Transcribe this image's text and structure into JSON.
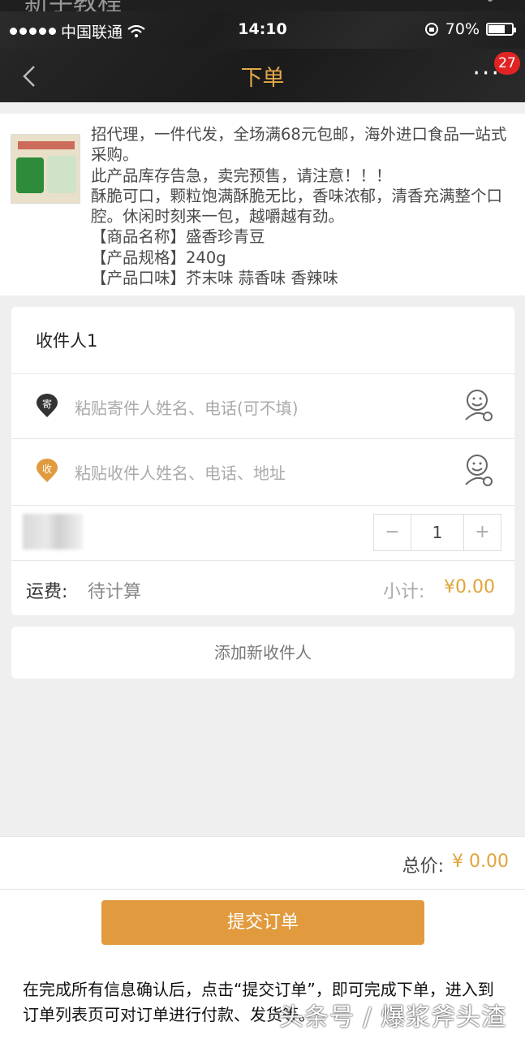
{
  "top_clip": {
    "text": "新手教程"
  },
  "status_bar": {
    "carrier": "中国联通",
    "time": "14:10",
    "battery": "70%",
    "battery_level": 0.7,
    "wifi_icon": "wifi-icon",
    "lock_icon": "rotation-lock-icon"
  },
  "nav": {
    "title": "下单",
    "back_icon": "chevron-left-icon",
    "more_icon": "ellipsis-icon",
    "badge": "27"
  },
  "product": {
    "lines": [
      "招代理，一件代发，全场满68元包邮，海外进口食品一站式采购。",
      "此产品库存告急，卖完预售，请注意！！！",
      "酥脆可口，颗粒饱满酥脆无比，香味浓郁，清香充满整个口腔。休闲时刻来一包，越嚼越有劲。",
      "【商品名称】盛香珍青豆",
      "【产品规格】240g",
      "【产品口味】芥末味  蒜香味 香辣味"
    ]
  },
  "receiver": {
    "title": "收件人1",
    "sender_badge": "寄",
    "sender_placeholder": "粘贴寄件人姓名、电话(可不填)",
    "recipient_badge": "收",
    "recipient_placeholder": "粘贴收件人姓名、电话、地址",
    "contact_icon": "contact-icon",
    "quantity": "1",
    "minus": "−",
    "plus": "+",
    "shipping_label": "运费:",
    "shipping_value": "待计算",
    "subtotal_label": "小计:",
    "subtotal_value": "¥0.00"
  },
  "add_receiver": {
    "label": "添加新收件人"
  },
  "footer": {
    "total_label": "总价:",
    "total_value": "¥ 0.00",
    "submit_label": "提交订单"
  },
  "caption": "在完成所有信息确认后，点击“提交订单”，即可完成下单，进入到订单列表页可对订单进行付款、发货等。",
  "watermark": "头条号 / 爆浆斧头渣",
  "colors": {
    "accent": "#e19b3e",
    "nav_title": "#e3a84a",
    "badge": "#e02424",
    "sender_pin": "#333333",
    "recipient_pin": "#e19b3e"
  }
}
